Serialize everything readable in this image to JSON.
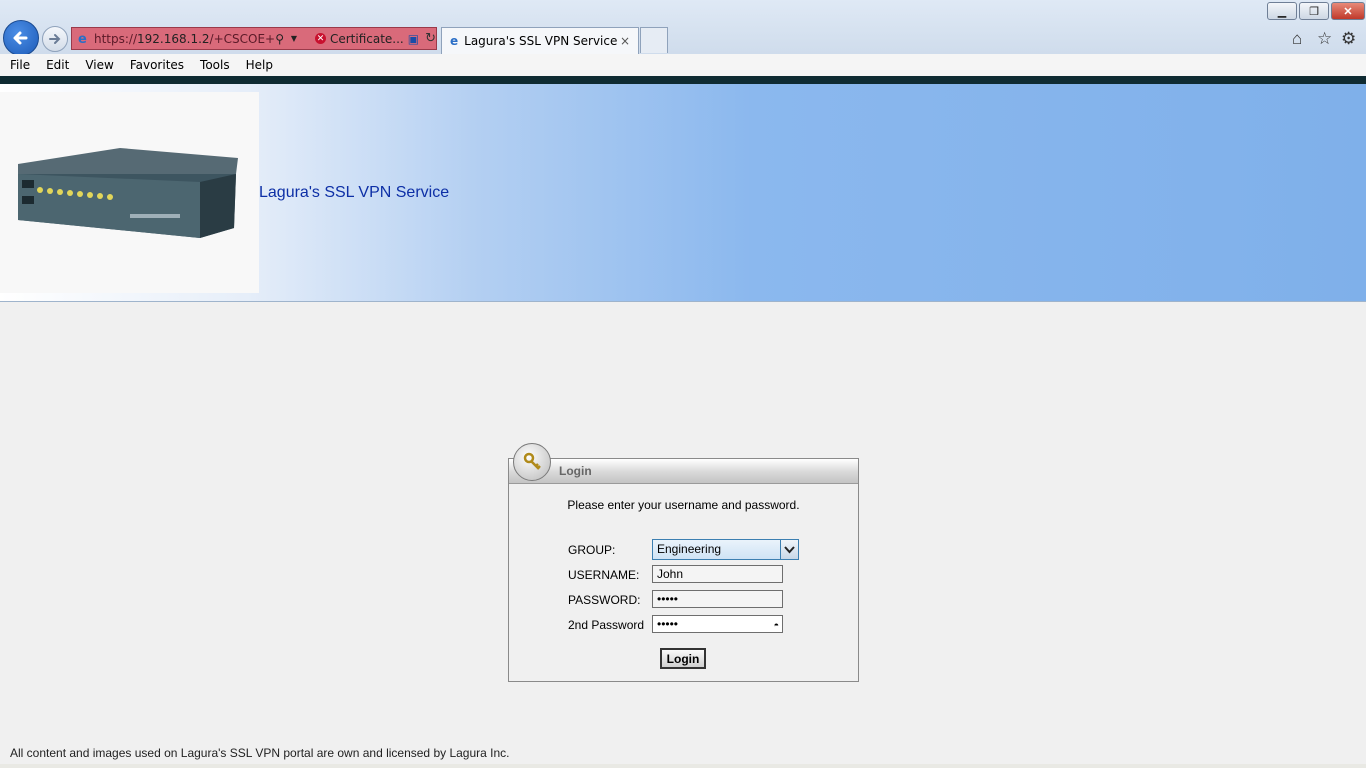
{
  "browser": {
    "address": {
      "prefix": "https://",
      "host": "192.168.1.2",
      "path": "/+CSCOE+/logo"
    },
    "cert_error": "Certificate...",
    "tab_title": "Lagura's SSL VPN Service",
    "tab_close": "×",
    "window": {
      "minimize": "▁",
      "maximize": "❐",
      "close": "✕"
    },
    "menu": [
      "File",
      "Edit",
      "View",
      "Favorites",
      "Tools",
      "Help"
    ]
  },
  "banner": {
    "title": "Lagura's SSL VPN Service"
  },
  "login": {
    "header": "Login",
    "prompt": "Please enter your username and password.",
    "group_label": "GROUP:",
    "group_value": "Engineering",
    "username_label": "USERNAME:",
    "username_value": "John",
    "password_label": "PASSWORD:",
    "password_value": "•••••",
    "password2_label": "2nd Password",
    "password2_value": "•••••",
    "button": "Login"
  },
  "footer": {
    "text": "All content and images used on Lagura's SSL VPN portal are own and licensed by Lagura Inc."
  },
  "colors": {
    "banner_text": "#0d2fa6",
    "address_error": "#d96a7a",
    "dark_bar": "#0f2b32"
  }
}
